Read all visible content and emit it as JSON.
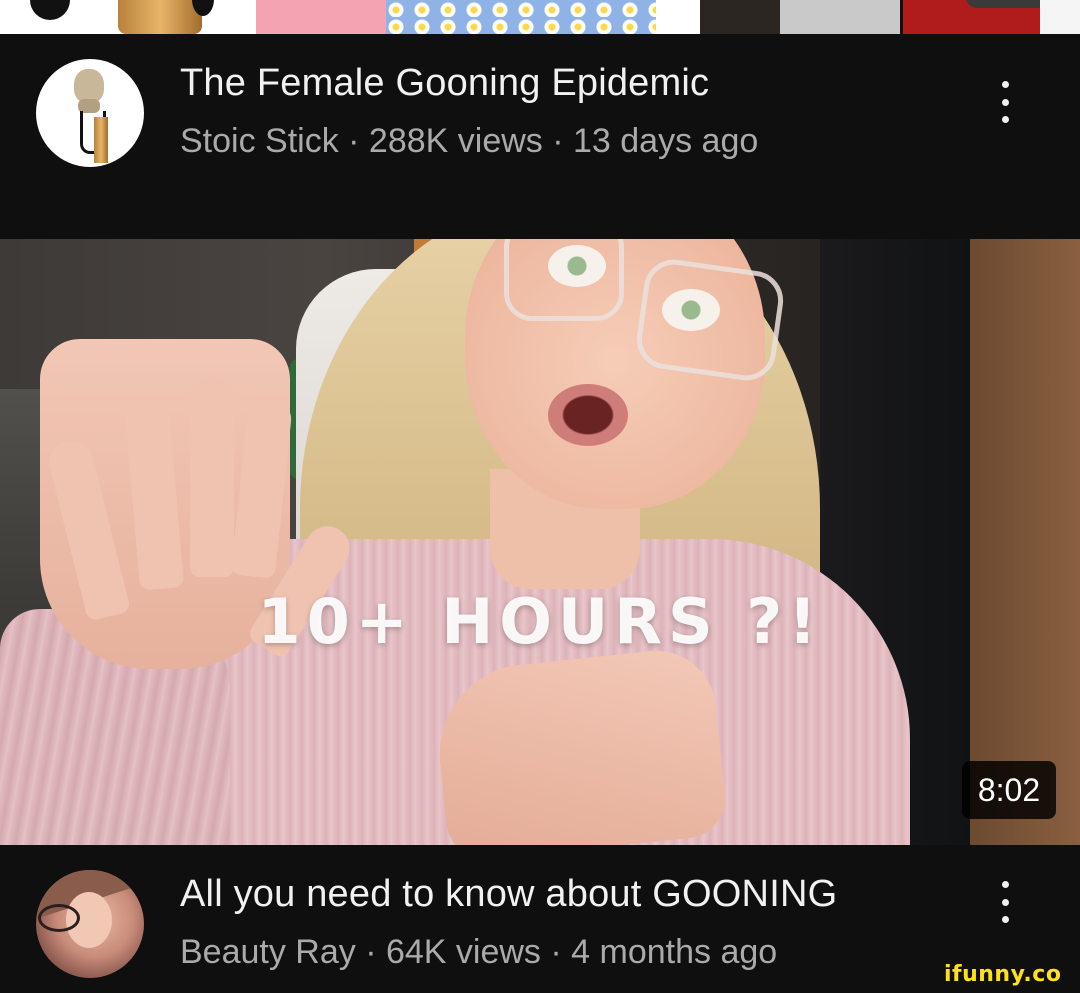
{
  "videos": [
    {
      "title": "The Female Gooning Epidemic",
      "channel": "Stoic Stick",
      "views": "288K views",
      "age": "13 days ago",
      "subline": "Stoic Stick · 288K views · 13 days ago",
      "avatar": "stoic-bust-stick-avatar"
    },
    {
      "title": "All you need to know about GOONING",
      "channel": "Beauty Ray",
      "views": "64K views",
      "age": "4 months ago",
      "subline": "Beauty Ray · 64K views · 4 months ago",
      "avatar": "beauty-ray-avatar",
      "thumbnail_text": "10+ HOURS ?!",
      "duration": "8:02"
    }
  ],
  "watermark": "ifunny.co",
  "icons": {
    "more": "kebab-menu-icon"
  },
  "colors": {
    "background": "#0f0f0f",
    "title": "#f1f1f1",
    "secondary_text": "#aaaaaa",
    "watermark": "#ffe01a"
  }
}
